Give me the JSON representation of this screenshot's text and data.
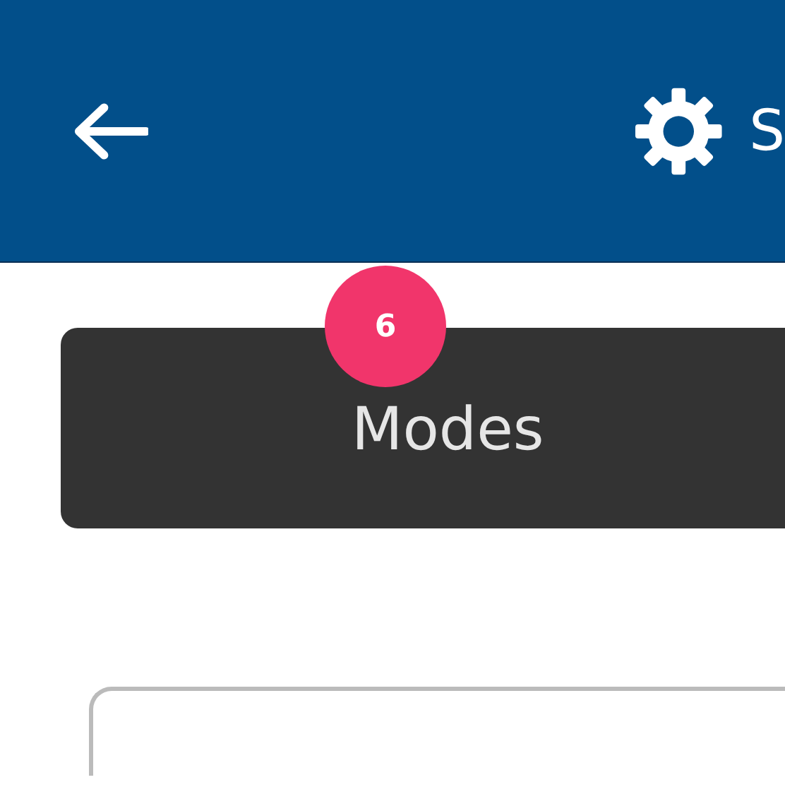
{
  "header": {
    "title": "S"
  },
  "modes_button": {
    "label": "Modes",
    "badge": "6"
  }
}
